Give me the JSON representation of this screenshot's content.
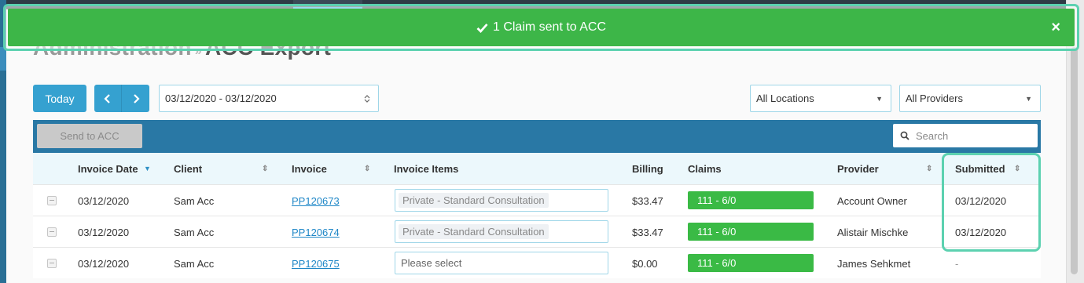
{
  "page": {
    "breadcrumb_parent": "Administration",
    "breadcrumb_separator": "»",
    "breadcrumb_current": "ACC Export"
  },
  "toolbar": {
    "today_label": "Today",
    "date_range": "03/12/2020 - 03/12/2020",
    "locations": "All Locations",
    "providers": "All Providers",
    "send_label": "Send to ACC",
    "search_placeholder": "Search"
  },
  "banner": {
    "message": "1 Claim sent to ACC",
    "close": "×",
    "color": "#3db648"
  },
  "table": {
    "headers": {
      "invoice_date": "Invoice Date",
      "client": "Client",
      "invoice": "Invoice",
      "invoice_items": "Invoice Items",
      "billing": "Billing",
      "claims": "Claims",
      "provider": "Provider",
      "submitted": "Submitted"
    },
    "rows": [
      {
        "date": "03/12/2020",
        "client": "Sam Acc",
        "invoice": "PP120673",
        "item": "Private - Standard Consultation",
        "billing": "$33.47",
        "claim": "111 - 6/0",
        "provider": "Account Owner",
        "submitted": "03/12/2020"
      },
      {
        "date": "03/12/2020",
        "client": "Sam Acc",
        "invoice": "PP120674",
        "item": "Private - Standard Consultation",
        "billing": "$33.47",
        "claim": "111 - 6/0",
        "provider": "Alistair Mischke",
        "submitted": "03/12/2020"
      },
      {
        "date": "03/12/2020",
        "client": "Sam Acc",
        "invoice": "PP120675",
        "item_placeholder": "Please select",
        "billing": "$0.00",
        "claim": "111 - 6/0",
        "provider": "James Sehkmet",
        "submitted": "-"
      }
    ]
  },
  "colors": {
    "accent": "#35a1d0",
    "toolbar_bg": "#2978a5",
    "claim_green": "#3aba45",
    "highlight": "#5cd1b0"
  }
}
